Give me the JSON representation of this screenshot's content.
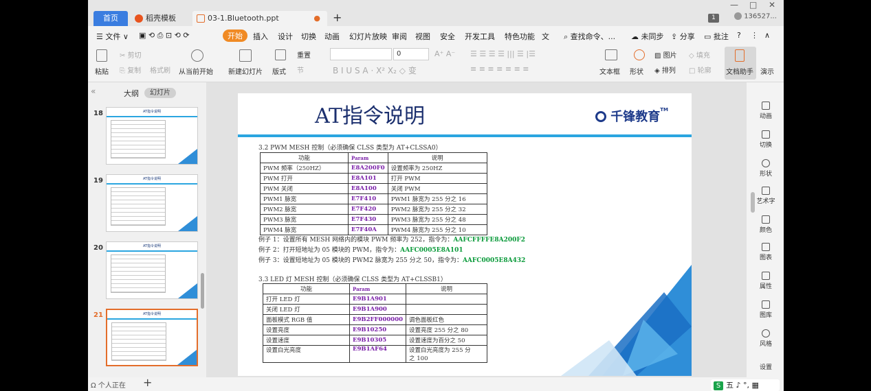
{
  "titlebar": {
    "tab_home": "首页",
    "tab_docer": "稻壳模板",
    "tab_file": "03-1.Bluetooth.ppt",
    "tab_add": "+",
    "win_minimize": "—",
    "win_maximize": "□",
    "win_close": "✕",
    "page_badge": "1",
    "user": "1365​27..."
  },
  "menubar": {
    "file": "☰ 文件 ∨",
    "items": [
      "开始",
      "插入",
      "设计",
      "切换",
      "动画",
      "幻灯片放映",
      "审阅",
      "视图",
      "安全",
      "开发工具",
      "特色功能",
      "文"
    ],
    "search": "查找命令、...",
    "sync": "未同步",
    "share": "分享",
    "comment": "批注",
    "help": "?"
  },
  "ribbon": {
    "paste": "粘贴",
    "cut": "剪切",
    "copy": "复制",
    "format_painter": "格式刷",
    "play_from_current": "从当前开始",
    "new_slide": "新建幻灯片",
    "layout": "版式",
    "section": "节",
    "reset": "重置",
    "font_size": "0",
    "text_box": "文本框",
    "shape": "形状",
    "arrange": "排列",
    "picture": "图片",
    "fill": "填充",
    "outline": "轮廓",
    "doc_assistant": "文档助手",
    "present": "演示"
  },
  "leftpanel": {
    "tab_outline": "大纲",
    "tab_slides": "幻灯片",
    "thumb_title": "AT指令说明",
    "thumbs": [
      "18",
      "19",
      "20",
      "21"
    ]
  },
  "slide": {
    "title": "AT指令说明",
    "logo": "千锋教育",
    "logo_tm": "TM",
    "sec1": "3.2 PWM MESH 控制（必须确保 CLSS 类型为 AT+CLSSA0）",
    "table1_headers": [
      "功能",
      "Param",
      "说明"
    ],
    "table1": [
      [
        "PWM 频率（250HZ）",
        "E8A200F0",
        "设置频率为 250HZ"
      ],
      [
        "PWM 打开",
        "E8A101",
        "打开 PWM"
      ],
      [
        "PWM 关闭",
        "E8A100",
        "关闭 PWM"
      ],
      [
        "PWM1 脉宽",
        "E7F410",
        "PWM1 脉宽为 255 分之 16"
      ],
      [
        "PWM2 脉宽",
        "E7F420",
        "PWM2 脉宽为 255 分之 32"
      ],
      [
        "PWM3 脉宽",
        "E7F430",
        "PWM3 脉宽为 255 分之 48"
      ],
      [
        "PWM4 脉宽",
        "E7F40A",
        "PWM4 脉宽为 255 分之 10"
      ]
    ],
    "example1_text": "例子 1：设置所有 MESH 网络内的模块 PWM 频率为 252，指令为：",
    "example1_cmd": "AAFCFFFFE8A200F2",
    "example2_text": "例子 2：打开短地址为 05 模块的 PWM，指令为：",
    "example2_cmd": "AAFC0005E8A101",
    "example3_text": "例子 3：设置短地址为 05 模块的 PWM2 脉宽为 255 分之 50，指令为：",
    "example3_cmd": "AAFC0005E8A432",
    "sec2": "3.3 LED 灯 MESH 控制（必须确保 CLSS 类型为 AT+CLSSB1）",
    "table2_headers": [
      "功能",
      "Param",
      "说明"
    ],
    "table2": [
      [
        "打开 LED 灯",
        "E9B1A901",
        ""
      ],
      [
        "关闭 LED 灯",
        "E9B1A900",
        ""
      ],
      [
        "面板模式 RGB 值",
        "E9B2FF000000",
        "调色面板红色"
      ],
      [
        "设置亮度",
        "E9B10250",
        "设置亮度 255 分之 80"
      ],
      [
        "设置速度",
        "E9B10305",
        "设置速度为百分之 50"
      ],
      [
        "设置白光亮度",
        "E9B1AF64",
        "设置白光亮度为 255 分"
      ]
    ],
    "table2_last_cont": "之 100"
  },
  "rightbar": {
    "items": [
      "动画",
      "切换",
      "形状",
      "艺术字",
      "颜色",
      "图表",
      "属性",
      "图库",
      "风格",
      "设置"
    ]
  },
  "statusbar": {
    "text": "Ω 个人正在",
    "add": "+",
    "ime": "五 ♪ °, ▦"
  },
  "colors": {
    "accent_orange": "#f08a24",
    "home_blue": "#3a7de0",
    "slide_bar": "#2aa5e0",
    "title_navy": "#1b2f6e",
    "param_purple": "#7a1fa8",
    "cmd_green": "#0a9a3a"
  }
}
